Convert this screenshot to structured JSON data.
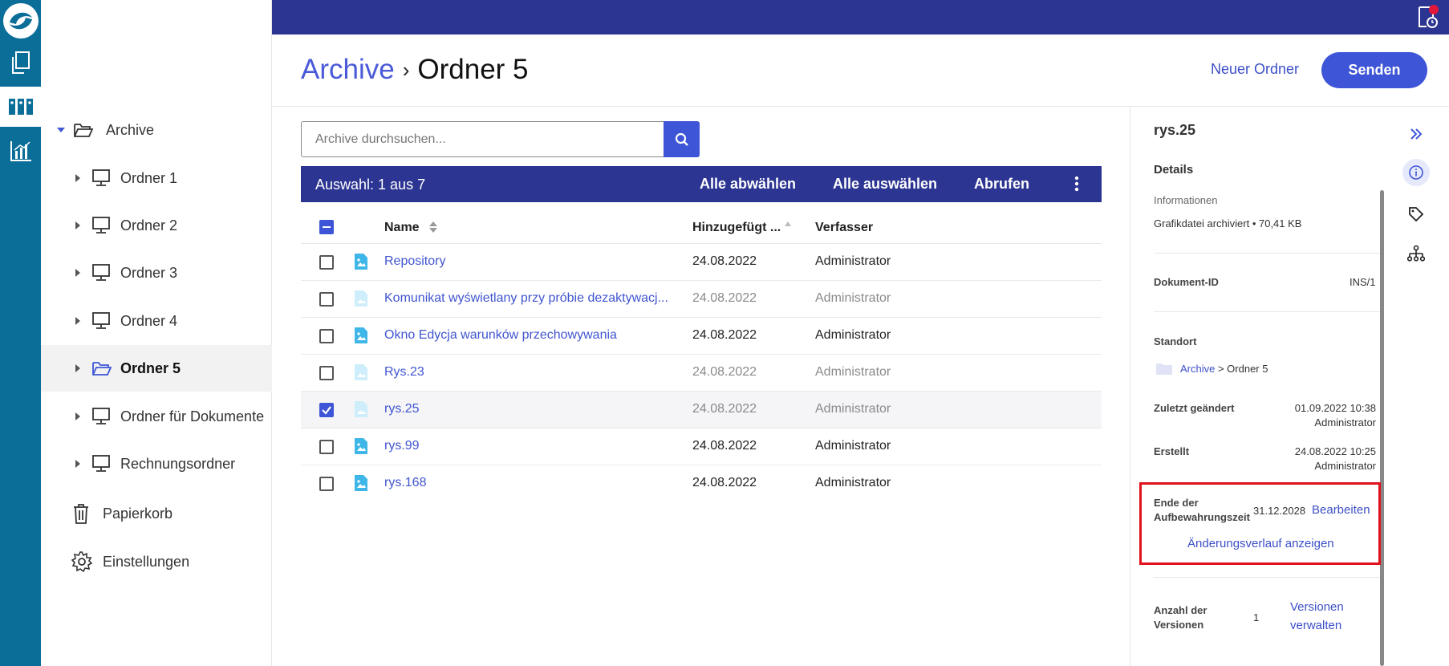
{
  "header": {
    "breadcrumb_root": "Archive",
    "breadcrumb_sep": "›",
    "breadcrumb_current": "Ordner 5",
    "new_folder": "Neuer Ordner",
    "send": "Senden"
  },
  "sidebar": {
    "items": [
      {
        "label": "Archive"
      },
      {
        "label": "Ordner 1"
      },
      {
        "label": "Ordner 2"
      },
      {
        "label": "Ordner 3"
      },
      {
        "label": "Ordner 4"
      },
      {
        "label": "Ordner 5"
      },
      {
        "label": "Ordner für Dokumente"
      },
      {
        "label": "Rechnungsordner"
      },
      {
        "label": "Papierkorb"
      },
      {
        "label": "Einstellungen"
      }
    ]
  },
  "search": {
    "placeholder": "Archive durchsuchen..."
  },
  "selection": {
    "count": "Auswahl: 1 aus 7",
    "deselect_all": "Alle abwählen",
    "select_all": "Alle auswählen",
    "retrieve": "Abrufen"
  },
  "table": {
    "col_name": "Name",
    "col_added": "Hinzugefügt ...",
    "col_author": "Verfasser",
    "rows": [
      {
        "name": "Repository",
        "date": "24.08.2022",
        "author": "Administrator"
      },
      {
        "name": "Komunikat wyświetlany przy próbie dezaktywacj...",
        "date": "24.08.2022",
        "author": "Administrator"
      },
      {
        "name": "Okno Edycja warunków przechowywania",
        "date": "24.08.2022",
        "author": "Administrator"
      },
      {
        "name": "Rys.23",
        "date": "24.08.2022",
        "author": "Administrator"
      },
      {
        "name": "rys.25",
        "date": "24.08.2022",
        "author": "Administrator"
      },
      {
        "name": "rys.99",
        "date": "24.08.2022",
        "author": "Administrator"
      },
      {
        "name": "rys.168",
        "date": "24.08.2022",
        "author": "Administrator"
      }
    ]
  },
  "details": {
    "title": "rys.25",
    "section": "Details",
    "info_label": "Informationen",
    "info_value": "Grafikdatei archiviert •  70,41 KB",
    "docid_label": "Dokument-ID",
    "docid_value": "INS/1",
    "location_label": "Standort",
    "location_root": "Archive",
    "location_rest": " > Ordner 5",
    "modified_label": "Zuletzt geändert",
    "modified_date": "01.09.2022 10:38",
    "modified_by": "Administrator",
    "created_label": "Erstellt",
    "created_date": "24.08.2022 10:25",
    "created_by": "Administrator",
    "retention_label_1": "Ende der",
    "retention_label_2": "Aufbewahrungszeit",
    "retention_value": "31.12.2028",
    "retention_edit": "Bearbeiten",
    "history_link": "Änderungsverlauf anzeigen",
    "versions_label_1": "Anzahl der",
    "versions_label_2": "Versionen",
    "versions_value": "1",
    "versions_link_1": "Versionen",
    "versions_link_2": "verwalten"
  },
  "colors": {
    "rail": "#0b6e99",
    "topbar": "#2c3592",
    "accent": "#3d55d6",
    "link": "#4055d0",
    "highlight": "#e0121c"
  }
}
